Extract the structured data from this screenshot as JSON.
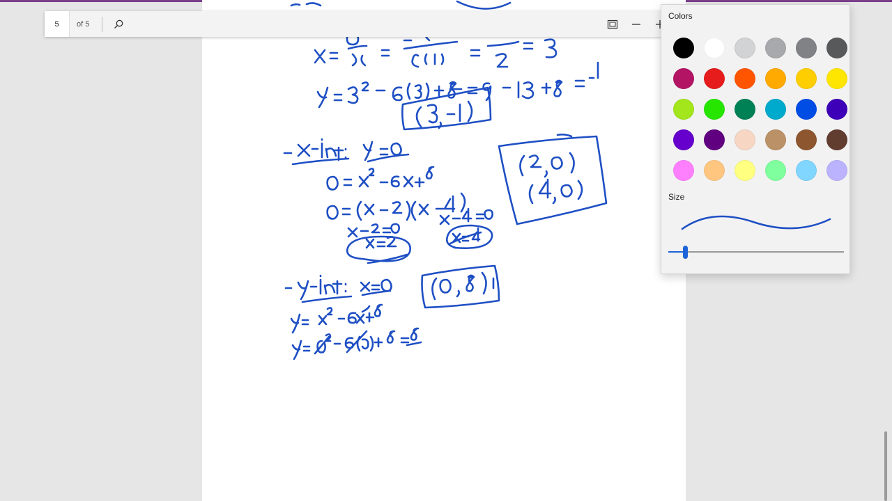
{
  "toolbar": {
    "page_number": "5",
    "page_count": "of 5",
    "icons": {
      "search": "search-icon",
      "fit": "fit-page-icon",
      "zoom_out": "minus-icon",
      "zoom_in": "plus-icon"
    }
  },
  "flyout": {
    "colors_title": "Colors",
    "size_title": "Size",
    "ink_color": "#1e4fc4",
    "selected_color": "#0f5ae0",
    "swatches": [
      "#000000",
      "#ffffff",
      "#d1d3d4",
      "#a7a9ac",
      "#808285",
      "#58595b",
      "#b31564",
      "#e61b1b",
      "#ff5500",
      "#ffaa00",
      "#ffce00",
      "#ffe600",
      "#a2e61b",
      "#26e600",
      "#008055",
      "#00aacc",
      "#004de6",
      "#3d00b8",
      "#6600cc",
      "#600080",
      "#f7d7c4",
      "#bb9167",
      "#8e562e",
      "#613d30",
      "#ff80ff",
      "#ffc680",
      "#ffff80",
      "#80ff9e",
      "#80d6ff",
      "#bcb3ff"
    ]
  }
}
